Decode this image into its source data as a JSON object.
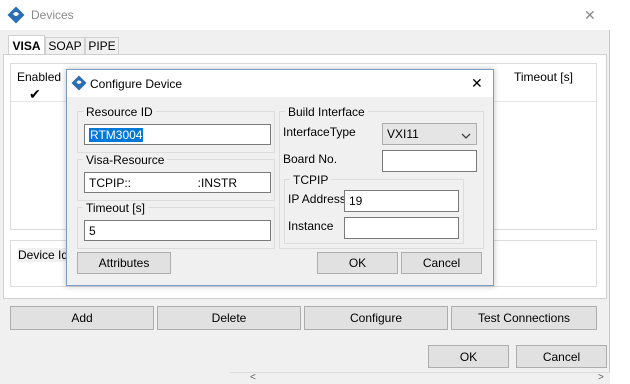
{
  "devices_window": {
    "title": "Devices",
    "close_glyph": "✕",
    "tabs": [
      "VISA",
      "SOAP",
      "PIPE"
    ],
    "table": {
      "col_enabled": "Enabled",
      "col_timeout": "Timeout [s]",
      "check_glyph": "✔"
    },
    "device_id_label": "Device Ide",
    "buttons": {
      "add": "Add",
      "delete": "Delete",
      "configure": "Configure",
      "test": "Test Connections",
      "ok": "OK",
      "cancel": "Cancel"
    },
    "scroll": {
      "left": "<",
      "right": ">"
    }
  },
  "dialog": {
    "title": "Configure Device",
    "close_glyph": "✕",
    "resource_id": {
      "label": "Resource ID",
      "value": "RTM3004"
    },
    "visa_resource": {
      "label": "Visa-Resource",
      "value": "TCPIP::                    :INSTR"
    },
    "timeout": {
      "label": "Timeout [s]",
      "value": "5"
    },
    "build_interface": {
      "label": "Build Interface",
      "interface_type_label": "InterfaceType",
      "interface_type_value": "VXI11",
      "board_no_label": "Board No.",
      "board_no_value": ""
    },
    "tcpip": {
      "label": "TCPIP",
      "ip_label": "IP Address",
      "ip_value": "19",
      "instance_label": "Instance",
      "instance_value": ""
    },
    "buttons": {
      "attributes": "Attributes",
      "ok": "OK",
      "cancel": "Cancel"
    }
  },
  "icons": {
    "app": "app-logo-icon",
    "dropdown": "chevron-down-icon",
    "close": "close-icon"
  },
  "colors": {
    "selection": "#0078d7",
    "dialog_border": "#7a9cc6",
    "window_bg": "#f0f0f0"
  }
}
